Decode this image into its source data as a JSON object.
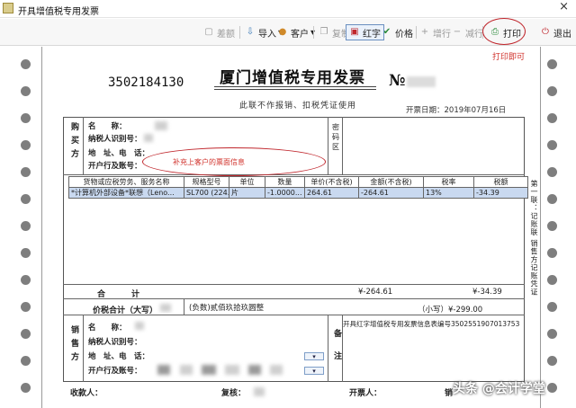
{
  "window": {
    "title": "开具增值税专用发票",
    "close": "×"
  },
  "toolbar": {
    "items": [
      {
        "label": "差额",
        "icon": "doc-icon",
        "glyph": "▢",
        "enabled": false
      },
      {
        "label": "导入",
        "icon": "import-icon",
        "glyph": "⇩",
        "enabled": true,
        "dropdown": "▾"
      },
      {
        "label": "客户",
        "icon": "customer-icon",
        "glyph": "●",
        "enabled": true,
        "dropdown": "▾"
      },
      {
        "label": "复制",
        "icon": "copy-icon",
        "glyph": "❐",
        "enabled": false
      },
      {
        "label": "红字",
        "icon": "red-invoice-icon",
        "glyph": "▣",
        "enabled": true
      },
      {
        "label": "价格",
        "icon": "price-icon",
        "glyph": "✔",
        "enabled": true
      },
      {
        "label": "增行",
        "icon": "add-row-icon",
        "glyph": "+",
        "enabled": false
      },
      {
        "label": "减行",
        "icon": "remove-row-icon",
        "glyph": "−",
        "enabled": false
      },
      {
        "label": "打印",
        "icon": "printer-icon",
        "glyph": "⎙",
        "enabled": true
      },
      {
        "label": "退出",
        "icon": "power-icon",
        "glyph": "⏻",
        "enabled": true
      }
    ],
    "print_hint": "打印即可"
  },
  "invoice": {
    "code": "3502184130",
    "title": "厦门增值税专用发票",
    "number_label": "№",
    "note": "此联不作报销、扣税凭证使用",
    "issue_date_label": "开票日期：",
    "issue_date": "2019年07月16日"
  },
  "buyer": {
    "section_label": "购买方",
    "name_label": "名　　称：",
    "taxid_label": "纳税人识别号：",
    "address_label": "地　址、电　话：",
    "bank_label": "开户行及账号：",
    "annotation": "补充上客户的票面信息",
    "cipher_label": "密码区"
  },
  "goods": {
    "headers": [
      "货物或应税劳务、服务名称",
      "规格型号",
      "单位",
      "数量",
      "单价(不含税)",
      "金额(不含税)",
      "税率",
      "税额"
    ],
    "rows": [
      [
        "*计算机外部设备*联想（Leno...",
        "SL700 (224...",
        "片",
        "-1.0000...",
        "264.61",
        "-264.61",
        "13%",
        "-34.39"
      ]
    ]
  },
  "totals": {
    "sum_label": "合　计",
    "sum_amount": "¥-264.61",
    "sum_tax": "¥-34.39",
    "grand_label": "价税合计（大写）",
    "grand_words": "(负数)贰佰玖拾玖圆整",
    "grand_small": "（小写）¥-299.00"
  },
  "seller": {
    "section_label": "销售方",
    "name_label": "名　　称：",
    "taxid_label": "纳税人识别号：",
    "address_label": "地　址、电　话：",
    "bank_label": "开户行及账号：",
    "remark_label": "备注",
    "remark": "开具红字增值税专用发票信息表编号3502551907013753"
  },
  "footer": {
    "payee_label": "收款人：",
    "reviewer_label": "复核：",
    "drawer_label": "开票人：",
    "seller_stamp_label": "销"
  },
  "side_caption": "第一联：记账联 销售方记账凭证",
  "watermark": "头条 @会计学堂",
  "colors": {
    "annotation": "#c0272d",
    "selected_row": "#c9d9f0"
  }
}
